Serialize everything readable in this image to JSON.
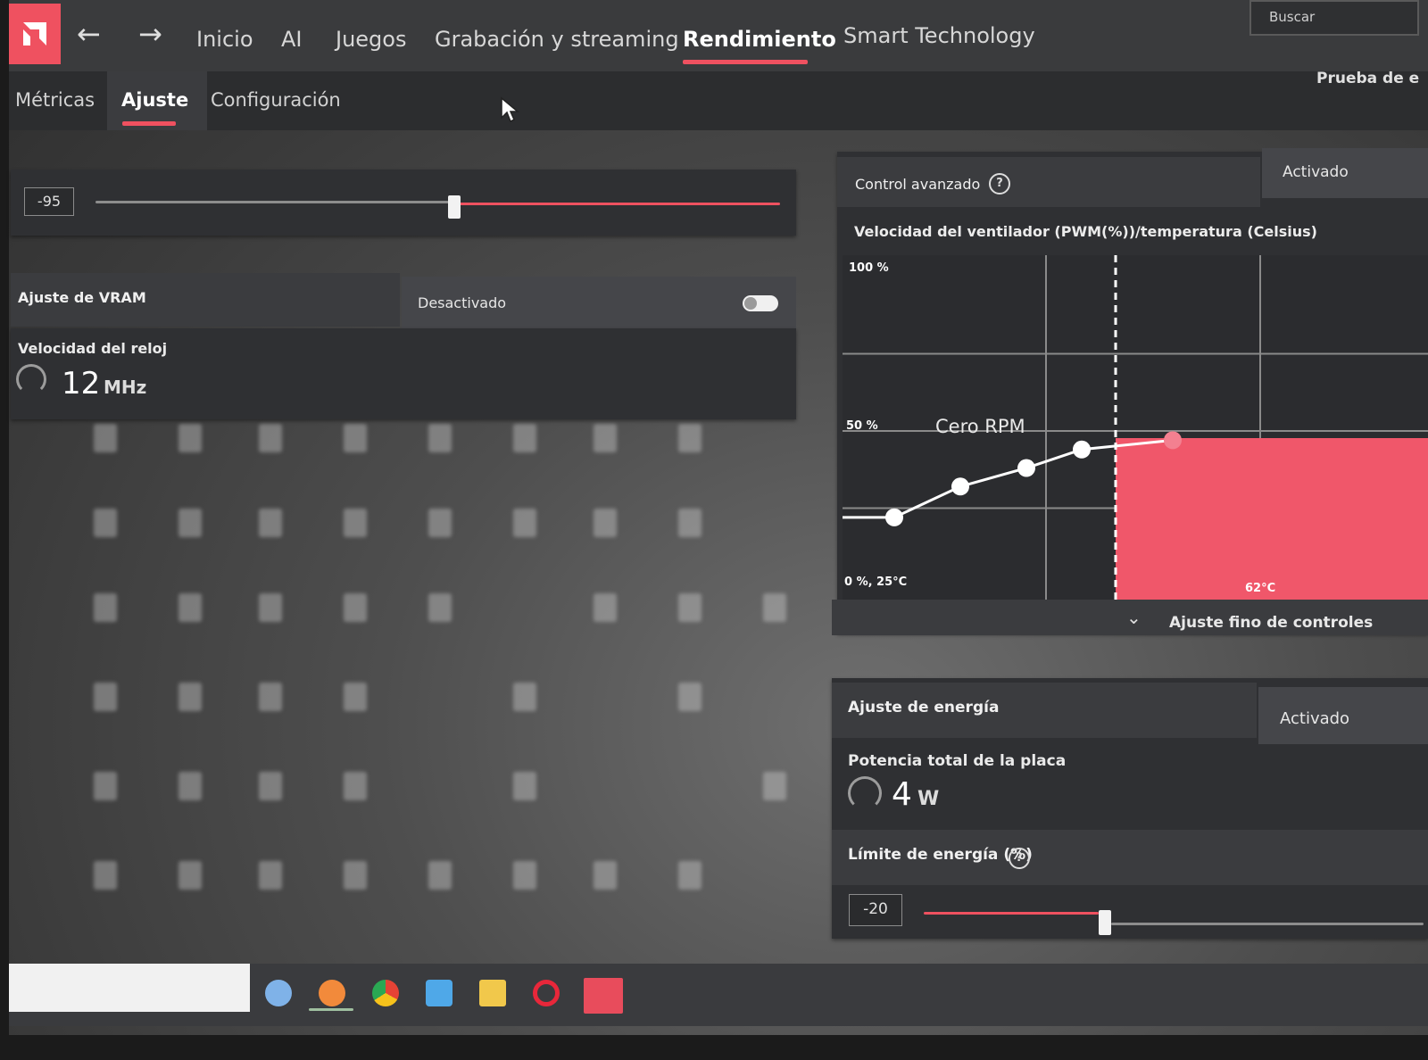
{
  "colors": {
    "accent": "#ef5160",
    "panel": "#2f3033",
    "header": "#3a3b3d"
  },
  "nav": {
    "items": [
      "Inicio",
      "AI",
      "Juegos",
      "Grabación y streaming",
      "Rendimiento",
      "Smart Technology"
    ],
    "active": "Rendimiento",
    "search_label": "Buscar",
    "back_icon": "arrow-left-icon",
    "forward_icon": "arrow-right-icon"
  },
  "subnav": {
    "tabs": [
      "Métricas",
      "Ajuste",
      "Configuración"
    ],
    "active": "Ajuste",
    "right_label": "Prueba de e"
  },
  "slider_top": {
    "value": "-95",
    "fill_fraction": 0.53
  },
  "vram": {
    "title": "Ajuste de VRAM",
    "state": "Desactivado",
    "clock_label": "Velocidad del reloj",
    "clock_value": "12",
    "clock_unit": "MHz"
  },
  "fan": {
    "control_label": "Control avanzado",
    "control_state": "Activado",
    "chart_title": "Velocidad del ventilador (PWM(%))/temperatura (Celsius)",
    "label_100": "100 %",
    "label_50": "50 %",
    "label_0": "0 %, 25°C",
    "zero_rpm_label": "Cero RPM",
    "temp_label": "62°C",
    "fine_tune_label": "Ajuste fino de controles"
  },
  "chart_data": {
    "type": "line",
    "title": "Velocidad del ventilador (PWM(%))/temperatura (Celsius)",
    "xlabel": "",
    "ylabel": "",
    "y_ticks": [
      "100 %",
      "50 %",
      "0 %, 25°C"
    ],
    "ylim": [
      0,
      100
    ],
    "series": [
      {
        "values": [
          22,
          32,
          38,
          44,
          47
        ]
      }
    ],
    "shaded_from_label": "62°C"
  },
  "energy": {
    "title": "Ajuste de energía",
    "state": "Activado",
    "board_power_label": "Potencia total de la placa",
    "board_power_value": "4",
    "board_power_unit": "W",
    "limit_label": "Límite de energía (%)",
    "limit_value": "-20",
    "limit_fraction": 0.35
  },
  "taskbar": {
    "icons": [
      "copilot-icon",
      "firefox-icon",
      "chrome-icon",
      "mail-icon",
      "folder-icon",
      "opera-icon",
      "amd-icon"
    ]
  }
}
